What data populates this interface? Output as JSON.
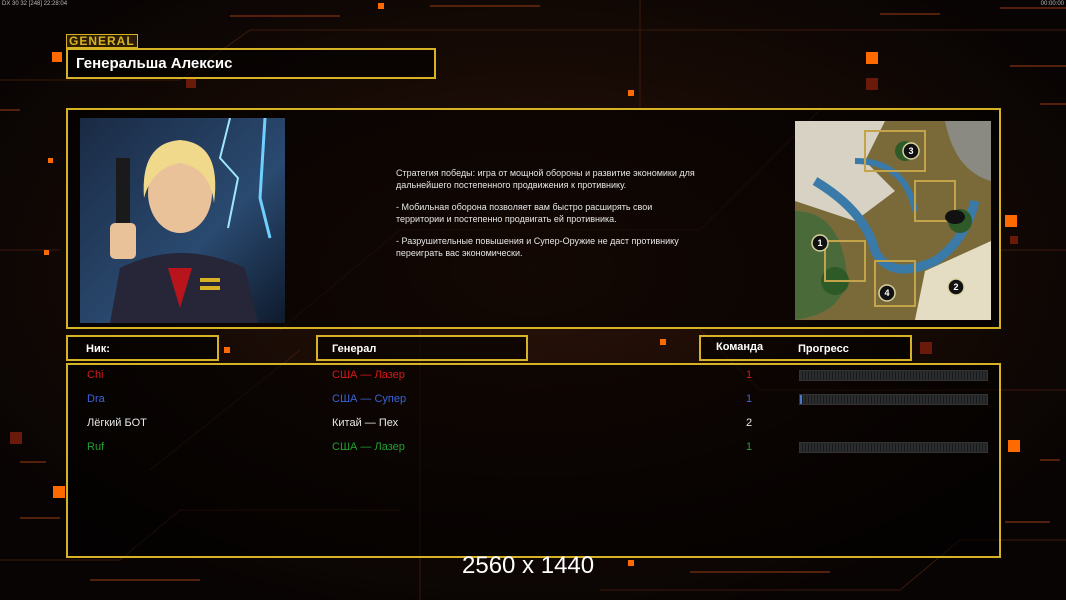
{
  "topbar": {
    "left_info": "DX 30 32 [248] 22:28:04",
    "right_info": "00:00:00"
  },
  "general_tag": "GENERAL",
  "general_name": "Генеральша Алексис",
  "description": [
    "Стратегия победы: игра от мощной обороны и развитие экономики для дальнейшего постепенного продвижения к противнику.",
    "- Мобильная оборона позволяет вам быстро расширять свои территории и постепенно продвигать ей противника.",
    "- Разрушительные повышения и Супер-Оружие не даст противнику переиграть вас экономически."
  ],
  "minimap": {
    "spawns": [
      "1",
      "2",
      "3",
      "4"
    ]
  },
  "headers": {
    "nick": "Ник:",
    "general": "Генерал",
    "team": "Команда",
    "progress": "Прогресс"
  },
  "players": [
    {
      "nick": "Chi",
      "general": "США — Лазер",
      "team": "1",
      "color": "#d81818",
      "progress": 0,
      "show_bar": true
    },
    {
      "nick": "Dra",
      "general": "США — Супер",
      "team": "1",
      "color": "#3a64d8",
      "progress": 0.01,
      "show_bar": true
    },
    {
      "nick": "Лёгкий БОТ",
      "general": "Китай — Пех",
      "team": "2",
      "color": "#e8e8e8",
      "progress": 0,
      "show_bar": false
    },
    {
      "nick": "Ruf",
      "general": "США — Лазер",
      "team": "1",
      "color": "#22a030",
      "progress": 0,
      "show_bar": true
    }
  ],
  "resolution_label": "2560 x 1440",
  "colors": {
    "frame": "#d8b225",
    "accent": "#ff6a00"
  }
}
